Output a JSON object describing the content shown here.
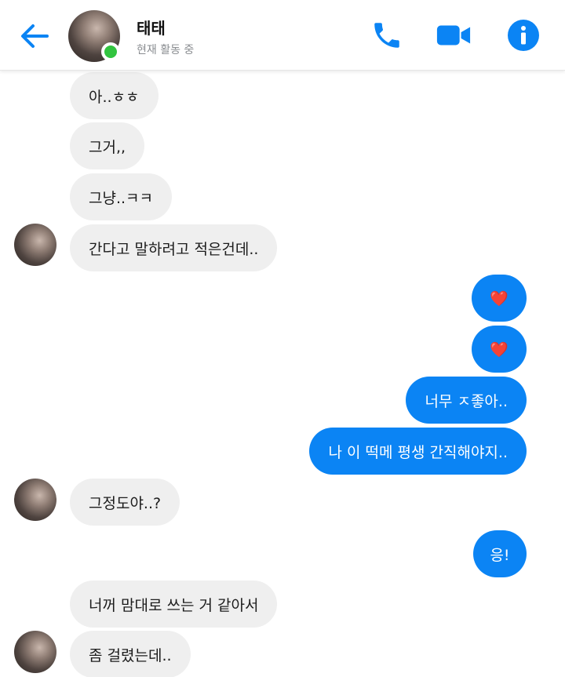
{
  "header": {
    "contact_name": "태태",
    "status": "현재 활동 중",
    "icons": [
      "back-arrow-icon",
      "phone-icon",
      "video-camera-icon",
      "info-icon"
    ]
  },
  "colors": {
    "accent": "#0b84f4",
    "online": "#31c43f",
    "incoming_bubble": "#efefef"
  },
  "messages": [
    {
      "side": "in",
      "text": "아..ㅎㅎ"
    },
    {
      "side": "in",
      "text": "그거,,"
    },
    {
      "side": "in",
      "text": "그냥..ㅋㅋ"
    },
    {
      "side": "in",
      "text": "간다고 말하려고 적은건데.."
    },
    {
      "side": "out",
      "text": "❤️"
    },
    {
      "side": "out",
      "text": "❤️"
    },
    {
      "side": "out",
      "text": "너무 ㅈ좋아.."
    },
    {
      "side": "out",
      "text": "나 이 떡메 평생 간직해야지.."
    },
    {
      "side": "in",
      "text": "그정도야..?"
    },
    {
      "side": "out",
      "text": "응!"
    },
    {
      "side": "in",
      "text": "너꺼 맘대로 쓰는 거 같아서"
    },
    {
      "side": "in",
      "text": "좀 걸렸는데.."
    }
  ]
}
